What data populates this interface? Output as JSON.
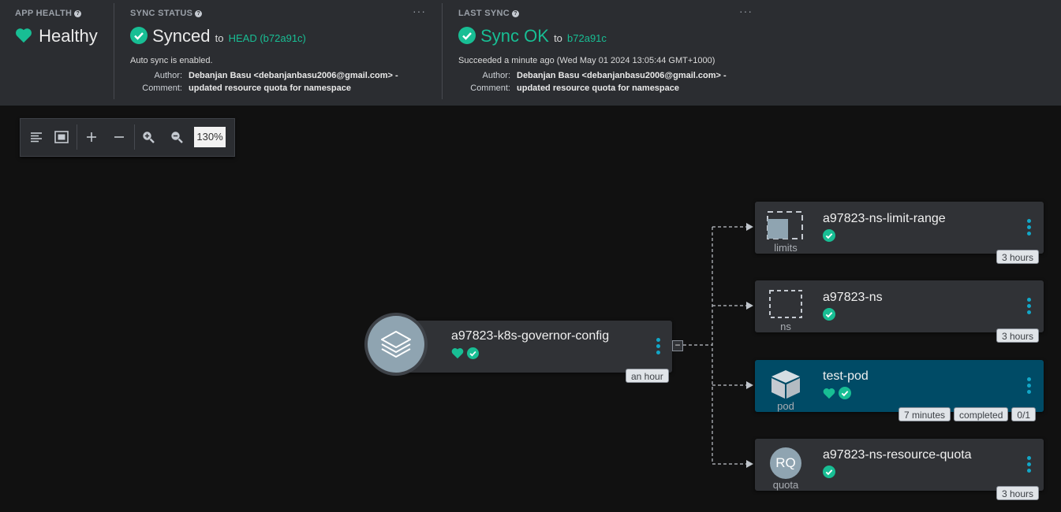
{
  "app_health": {
    "title": "APP HEALTH",
    "value": "Healthy"
  },
  "sync_status": {
    "title": "SYNC STATUS",
    "value": "Synced",
    "to_label": "to",
    "revision": "HEAD (b72a91c)",
    "auto_sync": "Auto sync is enabled.",
    "author_label": "Author:",
    "author": "Debanjan Basu <debanjanbasu2006@gmail.com> -",
    "comment_label": "Comment:",
    "comment": "updated resource quota for namespace"
  },
  "last_sync": {
    "title": "LAST SYNC",
    "value": "Sync OK",
    "to_label": "to",
    "revision": "b72a91c",
    "succeeded": "Succeeded a minute ago (Wed May 01 2024 13:05:44 GMT+1000)",
    "author_label": "Author:",
    "author": "Debanjan Basu <debanjanbasu2006@gmail.com> -",
    "comment_label": "Comment:",
    "comment": "updated resource quota for namespace"
  },
  "toolbar": {
    "zoom": "130%"
  },
  "root_node": {
    "name": "a97823-k8s-governor-config",
    "age": "an hour"
  },
  "resources": [
    {
      "name": "a97823-ns-limit-range",
      "kind": "limits",
      "age": "3 hours"
    },
    {
      "name": "a97823-ns",
      "kind": "ns",
      "age": "3 hours"
    },
    {
      "name": "test-pod",
      "kind": "pod",
      "age": "7 minutes",
      "state": "completed",
      "ready": "0/1"
    },
    {
      "name": "a97823-ns-resource-quota",
      "kind": "quota",
      "icon_text": "RQ",
      "age": "3 hours"
    }
  ],
  "colors": {
    "healthy": "#18be94",
    "accent": "#12a7c8",
    "selected_node": "#004b66",
    "background": "#111111",
    "panel": "#2b2d31"
  }
}
